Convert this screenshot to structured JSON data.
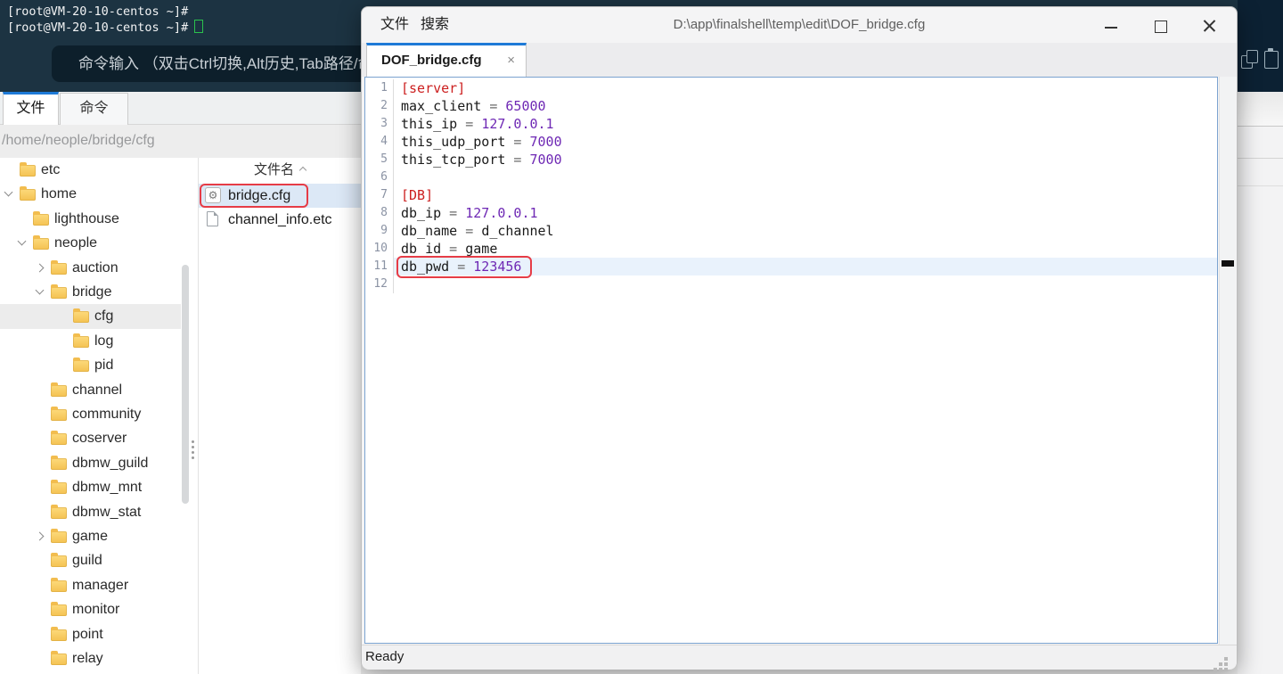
{
  "terminal": {
    "prompt_line1": "[root@VM-20-10-centos ~]#",
    "prompt_line2": "[root@VM-20-10-centos ~]#",
    "command_bar_hint": "命令输入 （双击Ctrl切换,Alt历史,Tab路径/命",
    "cursor_color": "#2bc24d",
    "bg_color": "#1c3342"
  },
  "main_panel": {
    "tabs": [
      {
        "label": "文件",
        "active": true
      },
      {
        "label": "命令",
        "active": false
      }
    ],
    "path": "/home/neople/bridge/cfg",
    "tree": [
      {
        "label": "etc",
        "level": 0,
        "expander": null,
        "selected": false
      },
      {
        "label": "home",
        "level": 0,
        "expander": "open",
        "selected": false
      },
      {
        "label": "lighthouse",
        "level": 1,
        "expander": null,
        "selected": false
      },
      {
        "label": "neople",
        "level": 1,
        "expander": "open",
        "selected": false
      },
      {
        "label": "auction",
        "level": 2,
        "expander": "closed",
        "selected": false
      },
      {
        "label": "bridge",
        "level": 2,
        "expander": "open",
        "selected": false
      },
      {
        "label": "cfg",
        "level": 3,
        "expander": null,
        "selected": true
      },
      {
        "label": "log",
        "level": 3,
        "expander": null,
        "selected": false
      },
      {
        "label": "pid",
        "level": 3,
        "expander": null,
        "selected": false
      },
      {
        "label": "channel",
        "level": 2,
        "expander": null,
        "selected": false
      },
      {
        "label": "community",
        "level": 2,
        "expander": null,
        "selected": false
      },
      {
        "label": "coserver",
        "level": 2,
        "expander": null,
        "selected": false
      },
      {
        "label": "dbmw_guild",
        "level": 2,
        "expander": null,
        "selected": false
      },
      {
        "label": "dbmw_mnt",
        "level": 2,
        "expander": null,
        "selected": false
      },
      {
        "label": "dbmw_stat",
        "level": 2,
        "expander": null,
        "selected": false
      },
      {
        "label": "game",
        "level": 2,
        "expander": "closed",
        "selected": false
      },
      {
        "label": "guild",
        "level": 2,
        "expander": null,
        "selected": false
      },
      {
        "label": "manager",
        "level": 2,
        "expander": null,
        "selected": false
      },
      {
        "label": "monitor",
        "level": 2,
        "expander": null,
        "selected": false
      },
      {
        "label": "point",
        "level": 2,
        "expander": null,
        "selected": false
      },
      {
        "label": "relay",
        "level": 2,
        "expander": null,
        "selected": false
      }
    ]
  },
  "file_list": {
    "header": "文件名",
    "rows": [
      {
        "name": "bridge.cfg",
        "icon": "gear-file-icon",
        "selected": true,
        "annotated": true
      },
      {
        "name": "channel_info.etc",
        "icon": "file-icon",
        "selected": false,
        "annotated": false
      }
    ]
  },
  "editor": {
    "menu": [
      "文件",
      "搜索"
    ],
    "title": "D:\\app\\finalshell\\temp\\edit\\DOF_bridge.cfg",
    "tab": {
      "label": "DOF_bridge.cfg",
      "close": "×"
    },
    "status": "Ready",
    "accent_color": "#1e7ad7",
    "annotation_color": "#e63c46",
    "code": {
      "syntax_colors": {
        "section": "#cc1f1f",
        "key": "#1a1a1a",
        "operator": "#6a6a6a",
        "number": "#6e28b4",
        "value": "#1a1a1a"
      },
      "lines": [
        {
          "num": 1,
          "tokens": [
            [
              "[server]",
              "section"
            ]
          ]
        },
        {
          "num": 2,
          "tokens": [
            [
              "max_client",
              "key"
            ],
            [
              " = ",
              "operator"
            ],
            [
              "65000",
              "number"
            ]
          ]
        },
        {
          "num": 3,
          "tokens": [
            [
              "this_ip",
              "key"
            ],
            [
              " = ",
              "operator"
            ],
            [
              "127.0.0.1",
              "number"
            ]
          ]
        },
        {
          "num": 4,
          "tokens": [
            [
              "this_udp_port",
              "key"
            ],
            [
              " = ",
              "operator"
            ],
            [
              "7000",
              "number"
            ]
          ]
        },
        {
          "num": 5,
          "tokens": [
            [
              "this_tcp_port",
              "key"
            ],
            [
              " = ",
              "operator"
            ],
            [
              "7000",
              "number"
            ]
          ]
        },
        {
          "num": 6,
          "tokens": []
        },
        {
          "num": 7,
          "tokens": [
            [
              "[DB]",
              "section"
            ]
          ]
        },
        {
          "num": 8,
          "tokens": [
            [
              "db_ip",
              "key"
            ],
            [
              " = ",
              "operator"
            ],
            [
              "127.0.0.1",
              "number"
            ]
          ]
        },
        {
          "num": 9,
          "tokens": [
            [
              "db_name",
              "key"
            ],
            [
              " = ",
              "operator"
            ],
            [
              "d_channel",
              "value"
            ]
          ]
        },
        {
          "num": 10,
          "tokens": [
            [
              "db_id",
              "key"
            ],
            [
              " = ",
              "operator"
            ],
            [
              "game",
              "value"
            ]
          ]
        },
        {
          "num": 11,
          "tokens": [
            [
              "db_pwd",
              "key"
            ],
            [
              " = ",
              "operator"
            ],
            [
              "123456",
              "number"
            ]
          ],
          "highlighted": true,
          "annotated": true
        },
        {
          "num": 12,
          "tokens": []
        }
      ]
    }
  }
}
